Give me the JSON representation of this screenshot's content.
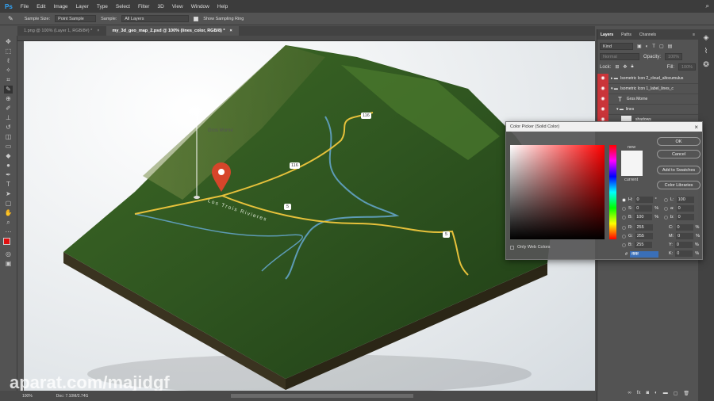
{
  "menu": {
    "logo": "Ps",
    "items": [
      "File",
      "Edit",
      "Image",
      "Layer",
      "Type",
      "Select",
      "Filter",
      "3D",
      "View",
      "Window",
      "Help"
    ]
  },
  "options": {
    "sample_size_label": "Sample Size:",
    "sample_size": "Point Sample",
    "sample_label": "Sample:",
    "sample": "All Layers",
    "show_ring": "Show Sampling Ring"
  },
  "tabs": [
    {
      "label": "1.png @ 100% (Layer 1, RGB/8#) *"
    },
    {
      "label": "my_3d_geo_map_2.psd @ 100% (lines_color, RGB/8) *"
    }
  ],
  "map": {
    "place": "Gros Morne",
    "river": "Los Trois Rivieres",
    "shields": [
      "116",
      "116",
      "5",
      "5"
    ]
  },
  "status": {
    "zoom": "100%",
    "doc": "Doc: 7.10M/2.74G"
  },
  "layers": {
    "tabs": [
      "Layers",
      "Paths",
      "Channels"
    ],
    "search": "Kind",
    "blend": "Normal",
    "opacity_label": "Opacity:",
    "opacity": "100%",
    "lock_label": "Lock:",
    "fill_label": "Fill:",
    "fill": "100%",
    "items": [
      {
        "name": "Isometric Icon 2_cloud_altocumulus",
        "icon": "folder"
      },
      {
        "name": "Isometric Icon 1_label_lines_c",
        "icon": "folder"
      },
      {
        "name": "Gros Morne",
        "icon": "T"
      },
      {
        "name": "lines",
        "icon": "folder"
      },
      {
        "name": "shadows",
        "icon": "thumb"
      }
    ]
  },
  "picker": {
    "title": "Color Picker (Solid Color)",
    "ok": "OK",
    "cancel": "Cancel",
    "add": "Add to Swatches",
    "libraries": "Color Libraries",
    "new": "new",
    "current": "current",
    "only_web": "Only Web Colors",
    "fields": {
      "H": "0",
      "S": "0",
      "B": "100",
      "R": "255",
      "G": "255",
      "B2": "255",
      "L": "100",
      "a": "0",
      "b": "0",
      "C": "0",
      "M": "0",
      "Y": "0",
      "K": "0",
      "hex": "ffffff"
    },
    "units": {
      "deg": "°",
      "pct": "%"
    }
  },
  "watermark": "aparat.com/majidgf"
}
